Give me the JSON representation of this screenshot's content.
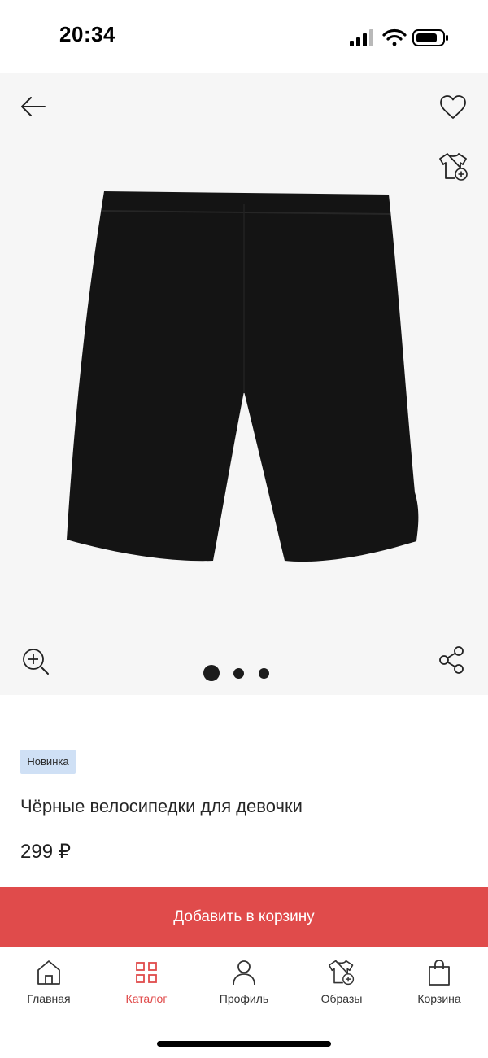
{
  "status_bar": {
    "time": "20:34"
  },
  "gallery": {
    "current_image": 1,
    "image_count": 3,
    "icons": {
      "back": "arrow-left-icon",
      "favorite": "heart-icon",
      "add_to_look": "tshirt-plus-icon",
      "zoom": "zoom-in-icon",
      "share": "share-icon"
    }
  },
  "product": {
    "badge": "Новинка",
    "title": "Чёрные велосипедки для девочки",
    "price": "299 ₽"
  },
  "actions": {
    "add_to_cart": "Добавить в корзину"
  },
  "tab_bar": {
    "items": [
      {
        "label": "Главная",
        "icon": "home-icon"
      },
      {
        "label": "Каталог",
        "icon": "grid-icon"
      },
      {
        "label": "Профиль",
        "icon": "person-icon"
      },
      {
        "label": "Образы",
        "icon": "tshirt-plus-icon"
      },
      {
        "label": "Корзина",
        "icon": "shopping-bag-icon"
      }
    ],
    "active_index": 1
  },
  "colors": {
    "accent": "#e04b4b",
    "badge_bg": "#cfe0f5",
    "gallery_bg": "#f6f6f6",
    "product": "#141414"
  }
}
